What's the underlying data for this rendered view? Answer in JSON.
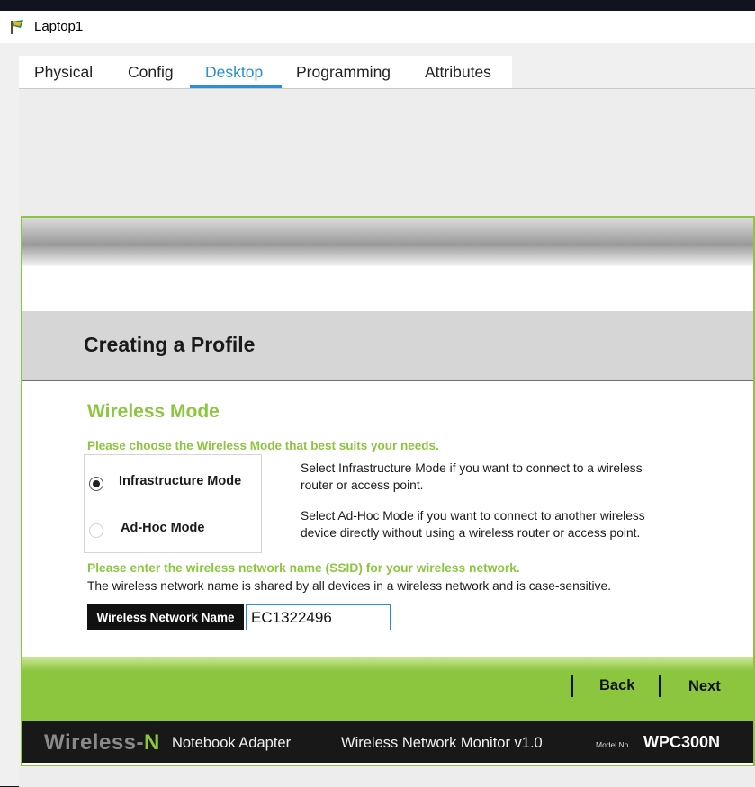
{
  "window": {
    "title": "Laptop1"
  },
  "tabs": [
    {
      "label": "Physical",
      "active": false
    },
    {
      "label": "Config",
      "active": false
    },
    {
      "label": "Desktop",
      "active": true
    },
    {
      "label": "Programming",
      "active": false
    },
    {
      "label": "Attributes",
      "active": false
    }
  ],
  "wizard": {
    "page_title": "Creating a Profile",
    "section_title": "Wireless Mode",
    "choose_prompt": "Please choose the Wireless Mode that best suits your needs.",
    "modes": [
      {
        "label": "Infrastructure Mode",
        "selected": true,
        "desc_line1": "Select Infrastructure Mode if you want to connect to a wireless",
        "desc_line2": "router or access point."
      },
      {
        "label": "Ad-Hoc Mode",
        "selected": false,
        "desc_line1": "Select Ad-Hoc Mode if you want to connect to another wireless",
        "desc_line2": "device directly without using a wireless router or access point."
      }
    ],
    "ssid_prompt": "Please enter the wireless network name (SSID) for your wireless network.",
    "ssid_note": "The wireless network name is shared by all devices in a wireless network and is case-sensitive.",
    "ssid_label": "Wireless Network Name",
    "ssid_value": "EC1322496",
    "back_label": "Back",
    "next_label": "Next"
  },
  "footer": {
    "brand_main": "Wireless-",
    "brand_accent": "N",
    "product": "Notebook Adapter",
    "monitor": "Wireless Network Monitor  v1.0",
    "model_prefix": "Model No.",
    "model_number": "WPC300N"
  },
  "colors": {
    "accent_green": "#8cc63f",
    "tab_active_blue": "#2a8fd6",
    "footer_bg": "#181818"
  },
  "icons": {
    "app_icon": "packet-tracer-laptop-icon"
  }
}
